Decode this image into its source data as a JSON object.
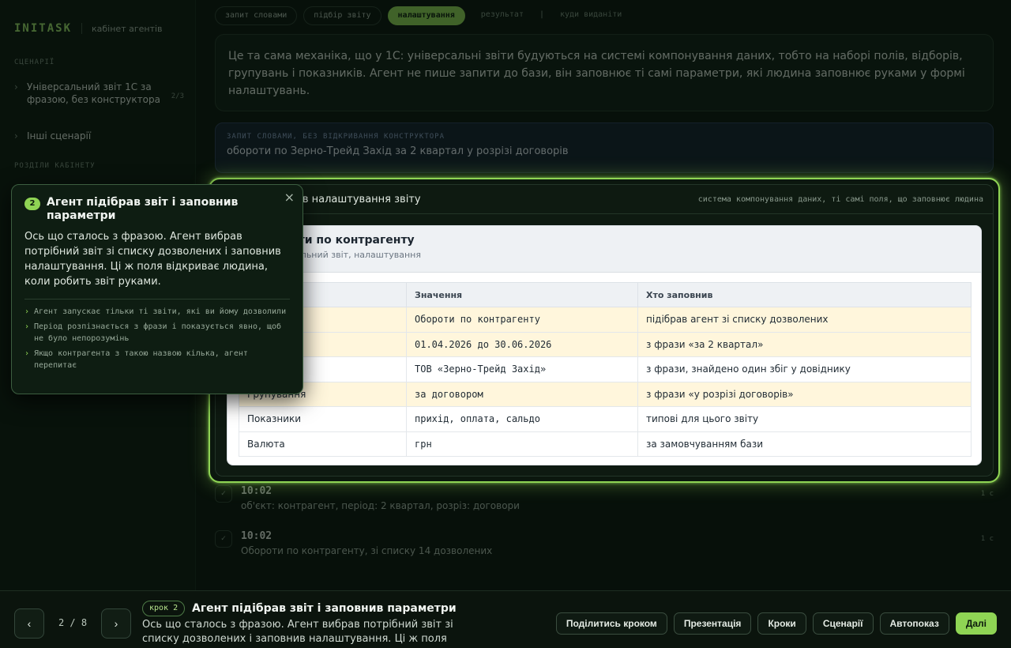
{
  "sidebar": {
    "logo": "INITASK",
    "subtitle": "кабінет агентів",
    "section_scenarios": "СЦЕНАРІЇ",
    "scenarios": [
      {
        "label": "Універсальний звіт 1С за фразою, без конструктора",
        "count": "2/3"
      },
      {
        "label": "Інші сценарії"
      }
    ],
    "section_company": "РОЗДІЛИ КАБІНЕТУ"
  },
  "stepper": {
    "chips": [
      "запит словами",
      "підбір звіту",
      "налаштування",
      "результат",
      "куди виданіти"
    ],
    "separator": "|"
  },
  "narration": "Це та сама механіка, що у 1С: універсальні звіти будуються на системі компонування даних, тобто на наборі полів, відборів, групувань і показників. Агент не пише запити до бази, він заповнює ті самі параметри, які людина заповнює руками у формі налаштувань.",
  "request": {
    "label": "ЗАПИТ СЛОВАМИ, БЕЗ ВІДКРИВАННЯ КОНСТРУКТОРА",
    "text": "обороти по Зерно-Трейд Захід за 2 квартал у розрізі договорів"
  },
  "panel": {
    "title": "ам заповнив налаштування звіту",
    "meta": "система компонування даних, ті самі поля, що заповнює людина",
    "card_title": "оти по контрагенту",
    "card_sub": "сальний звіт, налаштування",
    "columns": [
      "",
      "Значення",
      "Хто заповнив"
    ],
    "rows": [
      {
        "field": "",
        "value": "Обороти по контрагенту",
        "who": "підібрав агент зі списку дозволених"
      },
      {
        "field": "",
        "value": "01.04.2026 до 30.06.2026",
        "who": "з фрази «за 2 квартал»"
      },
      {
        "field": "трагент",
        "value": "ТОВ «Зерно-Трейд Захід»",
        "who": "з фрази, знайдено один збіг у довіднику"
      },
      {
        "field": "Групування",
        "value": "за договором",
        "who": "з фрази «у розрізі договорів»"
      },
      {
        "field": "Показники",
        "value": "прихід, оплата, сальдо",
        "who": "типові для цього звіту"
      },
      {
        "field": "Валюта",
        "value": "грн",
        "who": "за замовчуванням бази"
      }
    ]
  },
  "log": [
    {
      "badge": "✓",
      "time": "10:02",
      "text": "об'єкт: контрагент, період: 2 квартал, розріз: договори",
      "meta": "1 с"
    },
    {
      "badge": "✓",
      "time": "10:02",
      "text": "Обороти по контрагенту, зі списку 14 дозволених",
      "meta": "1 с"
    }
  ],
  "popover": {
    "number": "2",
    "title": "Агент підібрав звіт і заповнив параметри",
    "close": "×",
    "text": "Ось що сталось з фразою. Агент вибрав потрібний звіт зі списку дозволених і заповнив налаштування. Ці ж поля відкриває людина, коли робить звіт руками.",
    "notes": [
      "Агент запускає тільки ті звіти, які ви йому дозволили",
      "Період розпізнається з фрази і показується явно, щоб не було непорозумінь",
      "Якщо контрагента з такою назвою кілька, агент перепитає"
    ]
  },
  "bottom": {
    "prev": "‹",
    "next": "›",
    "pager": "2 / 8",
    "step_chip": "крок 2",
    "step_title": "Агент підібрав звіт і заповнив параметри",
    "step_desc": "Ось що сталось з фразою. Агент вибрав потрібний звіт зі списку дозволених і заповнив налаштування. Ці ж поля відкриває…",
    "actions": [
      "Поділитись кроком",
      "Презентація",
      "Кроки",
      "Сценарії",
      "Автопоказ",
      "Далі"
    ]
  },
  "colors": {
    "accent": "#8fd454",
    "background": "#07100a",
    "highlight_row": "#fff6dc"
  }
}
